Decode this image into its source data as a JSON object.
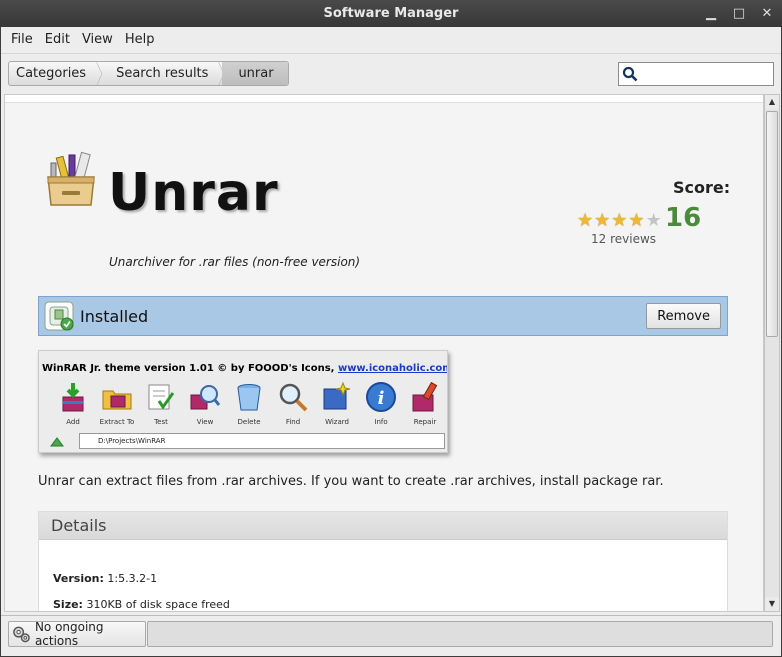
{
  "window": {
    "title": "Software Manager",
    "minimize": "▁",
    "maximize": "□",
    "close": "✕"
  },
  "menu": [
    "File",
    "Edit",
    "View",
    "Help"
  ],
  "breadcrumb": [
    "Categories",
    "Search results",
    "unrar"
  ],
  "search": {
    "value": "",
    "placeholder": ""
  },
  "app": {
    "name": "Unrar",
    "subtitle": "Unarchiver for .rar files (non-free version)",
    "score_label": "Score:",
    "score": "16",
    "rating": 4,
    "rating_max": 5,
    "reviews": "12 reviews",
    "description": "Unrar can extract files from .rar archives. If you want to create .rar archives, install package rar."
  },
  "install": {
    "status": "Installed",
    "button": "Remove"
  },
  "screenshot": {
    "title_prefix": "WinRAR Jr. theme version 1.01 © by FOOOD's Icons, ",
    "title_link": "www.iconaholic.com",
    "tools": [
      "Add",
      "Extract To",
      "Test",
      "View",
      "Delete",
      "Find",
      "Wizard",
      "Info",
      "Repair"
    ],
    "path": "D:\\Projects\\WinRAR"
  },
  "details": {
    "heading": "Details",
    "version_label": "Version:",
    "version": "1:5.3.2-1",
    "size_label": "Size:",
    "size": "310KB of disk space freed"
  },
  "status": {
    "text": "No ongoing actions"
  },
  "colors": {
    "installed_bar": "#a8c8e6",
    "score": "#4a8a3a",
    "star": "#f0b63a"
  }
}
